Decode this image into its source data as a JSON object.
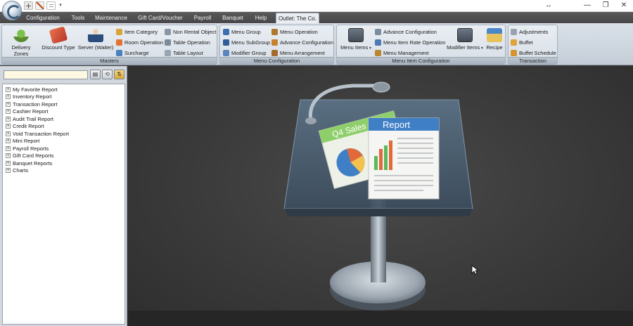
{
  "window": {
    "minimize": "—",
    "restore": "❐",
    "close": "✕",
    "resize_icon": "↔"
  },
  "tabs": [
    "Configuration",
    "Tools",
    "Maintenance",
    "Gift Card/Voucher",
    "Payroll",
    "Banquet",
    "Help",
    "Outlet: The Co."
  ],
  "ribbon": {
    "masters": {
      "title": "Masters",
      "delivery_zones": "Delivery Zones",
      "discount_type": "Discount Type",
      "server_waiter": "Server (Waiter)",
      "item_category": "Item Category",
      "room_operation": "Room Operation",
      "surcharge": "Surcharge",
      "non_rental_object": "Non Rental Object",
      "table_operation": "Table Operation",
      "table_layout": "Table Layout"
    },
    "menu_config": {
      "title": "Menu Configuration",
      "menu_group": "Menu Group",
      "menu_subgroup": "Menu SubGroup",
      "modifier_group": "Modifier Group",
      "menu_operation": "Menu Operation",
      "advance_configuration": "Advance Configuration",
      "menu_arrangement": "Menu Arrangement"
    },
    "menu_item_config": {
      "title": "Menu Item Configuration",
      "menu_items": "Menu Items",
      "advance_configuration": "Advance Configuration",
      "menu_item_rate_operation": "Menu Item Rate Operation",
      "menu_management": "Menu Management",
      "modifier_items": "Modifier Items",
      "recipe": "Recipe"
    },
    "transaction": {
      "title": "Transaction",
      "adjustments": "Adjustments",
      "buffet": "Buffet",
      "buffet_schedule": "Buffet Schedule"
    }
  },
  "search": {
    "value": "",
    "placeholder": ""
  },
  "tree": [
    "My Favorite Report",
    "Inventory Report",
    "Transaction Report",
    "Cashier Report",
    "Audit Trail Report",
    "Credit Report",
    "Void Transaction Report",
    "Mini Report",
    "Payroll Reports",
    "Gift Card Reports",
    "Banquet Reports",
    "Charts"
  ],
  "illustration": {
    "sheet_front": "Report",
    "sheet_back": "Q4 Sales"
  },
  "colors": {
    "tab_strip": "#4f4f4f",
    "ribbon": "#d3dbe3",
    "main_bg": "#3b3b3b",
    "search_bg": "#fdf8e2",
    "report_header": "#3f7fc6"
  }
}
